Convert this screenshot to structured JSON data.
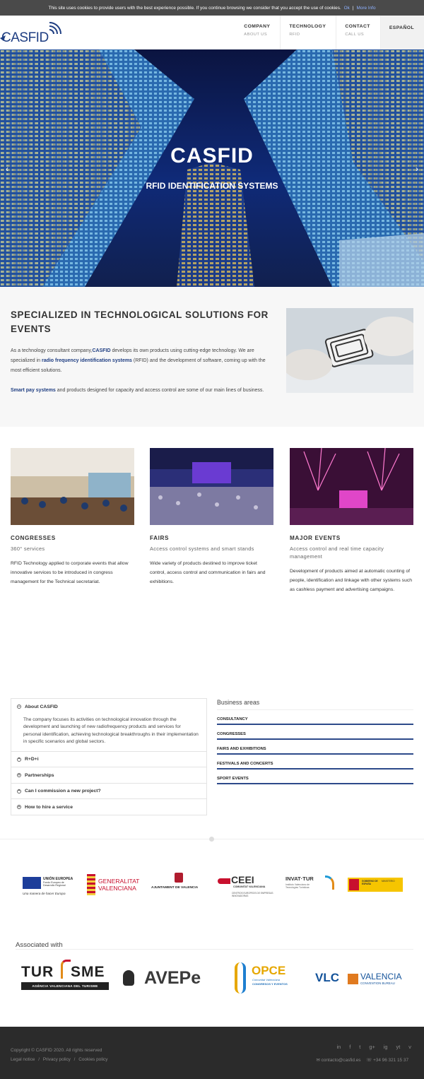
{
  "cookie": {
    "text": "This site uses cookies to provide users with the best experience possible. If you continue browsing we consider that you accept the use of cookies.",
    "ok": "Ok",
    "sep": "|",
    "more": "More Info"
  },
  "header": {
    "logo_text": "CASFID",
    "nav": [
      {
        "title": "COMPANY",
        "sub": "ABOUT US"
      },
      {
        "title": "TECHNOLOGY",
        "sub": "RFID"
      },
      {
        "title": "CONTACT",
        "sub": "CALL US"
      },
      {
        "title": "ESPAÑOL",
        "sub": ""
      }
    ]
  },
  "hero": {
    "title": "CASFID",
    "subtitle": "RFID IDENTIFICATION SYSTEMS",
    "prev": "‹",
    "next": "›"
  },
  "intro": {
    "heading": "SPECIALIZED IN TECHNOLOGICAL SOLUTIONS FOR EVENTS",
    "p1_a": "As a technology consultant company,",
    "p1_b": "CASFID",
    "p1_c": " develops its own products using cutting-edge technology. We are specialized in ",
    "p1_d": "radio frequency identification systems",
    "p1_e": " (RFID) and the development of software, coming up with the most efficient solutions.",
    "p2_a": "Smart pay systems",
    "p2_b": " and products designed for capacity and access control are some of our main lines of business."
  },
  "columns": [
    {
      "title": "CONGRESSES",
      "sub": "360° services",
      "text": "RFID Technology applied to corporate events that allow innovative services to be introduced in congress management for the Technical secretariat."
    },
    {
      "title": "FAIRS",
      "sub": "Access control systems and smart stands",
      "text": "Wide variety of products destined to improve ticket control, access control and communication in fairs and exhibitions."
    },
    {
      "title": "MAJOR EVENTS",
      "sub": "Access control and real time capacity management",
      "text": "Development of products aimed at automatic counting of people, identification and linkage with other systems such as cashless payment and advertising campaigns."
    }
  ],
  "accordion": {
    "items": [
      "About CASFID",
      "R+D+i",
      "Partnerships",
      "Can I commission a new project?",
      "How to hire a service"
    ],
    "open_text": "The company focuses its activities on technological innovation through the development and launching of new radiofrequency products and services for personal identification, achieving technological breakthroughs in their implementation in specific scenarios and global sectors.",
    "open_icon": "⊖",
    "closed_icon": "⊕"
  },
  "business": {
    "title": "Business areas",
    "items": [
      "CONSULTANCY",
      "CONGRESSES",
      "FAIRS AND EXHIBITIONS",
      "FESTIVALS AND CONCERTS",
      "SPORT EVENTS"
    ]
  },
  "partners": {
    "eu_1": "UNIÓN EUROPEA",
    "eu_2": "Fondo Europeo de Desarrollo Regional",
    "eu_3": "Una manera de hacer Europa",
    "gv": "GENERALITAT VALENCIANA",
    "gv_1": "GENERALITAT",
    "gv_2": "VALENCIANA",
    "ajv": "AJUNTAMENT DE VALENCIA",
    "ceei_1": "CEEI",
    "ceei_2": "COMUNITAT VALENCIANA",
    "ceei_3": "CENTROS EUROPEOS DE EMPRESAS INNOVADORAS",
    "invat_1": "INVAT·TUR",
    "invat_2": "Instituto Valenciano de Tecnologías Turísticas",
    "gob_1": "GOBIERNO DE ESPAÑA",
    "gob_2": "MINISTERIO"
  },
  "associated": {
    "title": "Associated with",
    "turisme_1": "TUR",
    "turisme_2": "SME",
    "turisme_3": "AGÈNCIA VALENCIANA DEL TURISME",
    "avepe": "AVEPe",
    "opce_1": "OPCE",
    "opce_2": "Comunitat Valenciana",
    "opce_3": "CONGRESOS Y EVENTOS",
    "vlc_1": "VLC",
    "vlc_2": "VALENCIA",
    "vlc_3": "CONVENTION BUREAU"
  },
  "footer": {
    "copyright": "Copyright © CASFID 2020. All rights reserved",
    "legal": "Legal notice",
    "privacy": "Privacy policy",
    "cookies": "Cookies policy",
    "divider": "/",
    "email": "contacto@casfid.es",
    "phone": "+34 96 321 15 37",
    "social": [
      "in",
      "f",
      "t",
      "g+",
      "ig",
      "yt",
      "v"
    ]
  },
  "colors": {
    "brand": "#1f3e82",
    "footer_bg": "#2b2b2b",
    "link": "#1f3e82"
  }
}
